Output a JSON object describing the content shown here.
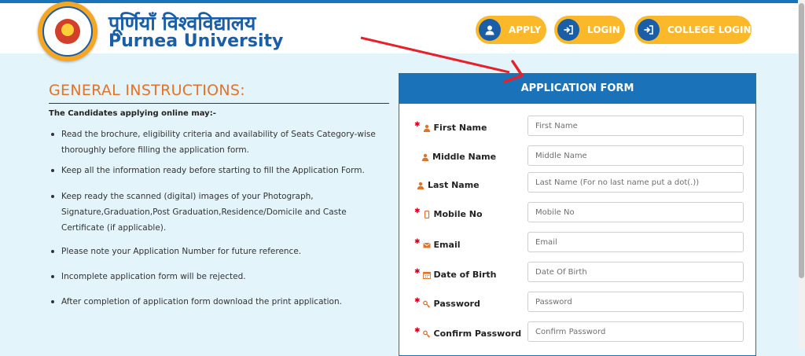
{
  "header": {
    "title_hindi": "पूर्णियाँ विश्वविद्यालय",
    "title_english": "Purnea University",
    "buttons": {
      "apply": "APPLY",
      "login": "LOGIN",
      "college_login": "COLLEGE LOGIN"
    }
  },
  "instructions": {
    "title": "GENERAL INSTRUCTIONS:",
    "subtitle": "The Candidates applying online may:-",
    "items": [
      "Read the brochure, eligibility criteria and availability of Seats Category-wise thoroughly before filling the application form.",
      "Keep all the information ready before starting to fill the Application Form.",
      "Keep ready the scanned (digital) images of your Photograph, Signature,Graduation,Post Graduation,Residence/Domicile and Caste Certificate (if applicable).",
      "Please note your Application Number for future reference.",
      "Incomplete application form will be rejected.",
      "After completion of application form download the print application."
    ]
  },
  "form": {
    "title": "APPLICATION FORM",
    "fields": [
      {
        "label": "First Name",
        "placeholder": "First Name",
        "required": true,
        "icon": "user-icon",
        "value": ""
      },
      {
        "label": "Middle Name",
        "placeholder": "Middle Name",
        "required": false,
        "icon": "user-icon",
        "value": ""
      },
      {
        "label": "Last Name",
        "placeholder": "Last Name (For no last name put a dot(.))",
        "required": false,
        "icon": "user-icon",
        "value": ""
      },
      {
        "label": "Mobile No",
        "placeholder": "Mobile No",
        "required": true,
        "icon": "mobile-icon",
        "value": ""
      },
      {
        "label": "Email",
        "placeholder": "Email",
        "required": true,
        "icon": "envelope-icon",
        "value": ""
      },
      {
        "label": "Date of Birth",
        "placeholder": "Date Of Birth",
        "required": true,
        "icon": "calendar-icon",
        "value": ""
      },
      {
        "label": "Password",
        "placeholder": "Password",
        "required": true,
        "icon": "key-icon",
        "value": ""
      },
      {
        "label": "Confirm Password",
        "placeholder": "Confirm Password",
        "required": true,
        "icon": "key-icon",
        "value": ""
      }
    ]
  },
  "colors": {
    "primary_blue": "#1a73b8",
    "button_yellow": "#fbb92a",
    "heading_orange": "#e2742a",
    "background": "#e3f4fb",
    "required_red": "#d0021b",
    "arrow_red": "#e8202a"
  }
}
